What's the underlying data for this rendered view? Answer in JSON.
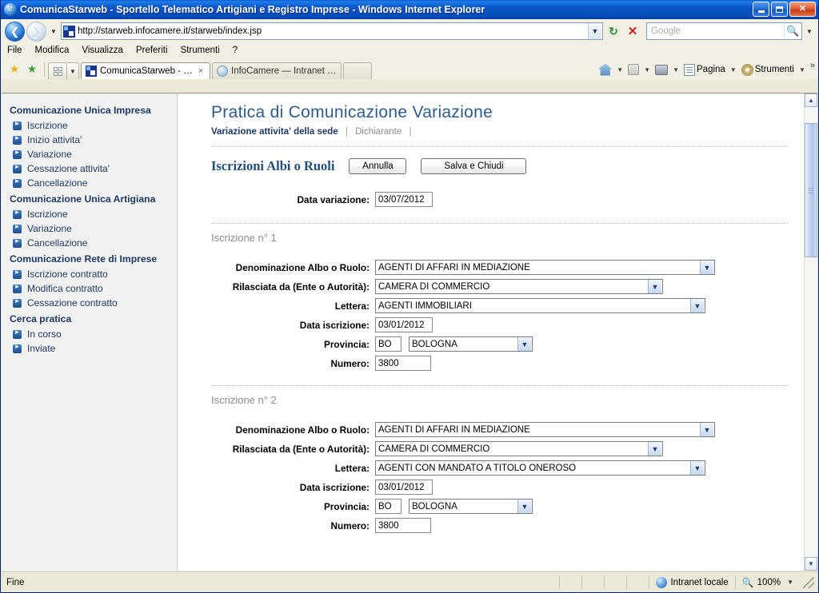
{
  "window": {
    "title": "ComunicaStarweb - Sportello Telematico Artigiani e Registro Imprese - Windows Internet Explorer",
    "minimize_label": "Riduci a icona",
    "maximize_label": "Ripristina",
    "close_label": "Chiudi"
  },
  "navigation": {
    "back_label": "Indietro",
    "forward_label": "Avanti",
    "history_caret": "▼",
    "url": "http://starweb.infocamere.it/starweb/index.jsp",
    "url_caret": "▼",
    "refresh_label": "Aggiorna",
    "stop_label": "Interrompi",
    "search_placeholder": "Google",
    "search_go_label": "Cerca",
    "search_caret": "▼"
  },
  "menubar": {
    "items": [
      "File",
      "Modifica",
      "Visualizza",
      "Preferiti",
      "Strumenti",
      "?"
    ]
  },
  "tabbar": {
    "favorites_label": "Preferiti",
    "add_favorite_label": "Aggiungi a Preferiti",
    "quicktabs_label": "Schede rapide",
    "quicktabs_caret": "▼",
    "tabs": [
      {
        "label": "ComunicaStarweb - Sport...",
        "close": "×",
        "active": true
      },
      {
        "label": "InfoCamere — Intranet Bolo...",
        "active": false
      },
      {
        "label": "",
        "active": false
      }
    ],
    "commands": [
      {
        "label": "",
        "icon": "home-icon",
        "caret": "▼"
      },
      {
        "label": "",
        "icon": "feed-icon",
        "caret": "▼"
      },
      {
        "label": "",
        "icon": "print-icon",
        "caret": "▼"
      },
      {
        "label": "Pagina",
        "icon": "page-icon",
        "caret": "▼"
      },
      {
        "label": "Strumenti",
        "icon": "gear-icon",
        "caret": "▼"
      }
    ],
    "more_label": "»"
  },
  "sidebar": {
    "groups": [
      {
        "title": "Comunicazione Unica Impresa",
        "items": [
          "Iscrizione",
          "Inizio attivita'",
          "Variazione",
          "Cessazione attivita'",
          "Cancellazione"
        ]
      },
      {
        "title": "Comunicazione Unica Artigiana",
        "items": [
          "Iscrizione",
          "Variazione",
          "Cancellazione"
        ]
      },
      {
        "title": "Comunicazione Rete di Imprese",
        "items": [
          "Iscrizione contratto",
          "Modifica contratto",
          "Cessazione contratto"
        ]
      },
      {
        "title": "Cerca pratica",
        "items": [
          "In corso",
          "Inviate"
        ]
      }
    ]
  },
  "main": {
    "page_title": "Pratica di Comunicazione Variazione",
    "breadcrumbs": [
      {
        "label": "Variazione attivita' della sede",
        "active": true
      },
      {
        "label": "Dichiarante",
        "active": false
      }
    ],
    "breadcrumb_separator": "|",
    "section_title": "Iscrizioni Albi o Ruoli",
    "buttons": {
      "cancel": "Annulla",
      "save_close": "Salva e Chiudi"
    },
    "data_variazione": {
      "label": "Data variazione:",
      "value": "03/07/2012"
    },
    "field_labels": {
      "denominazione": "Denominazione Albo o Ruolo:",
      "rilasciata": "Rilasciata da (Ente o Autorità):",
      "lettera": "Lettera:",
      "data_iscrizione": "Data iscrizione:",
      "provincia": "Provincia:",
      "numero": "Numero:"
    },
    "dropdown_caret": "▼",
    "iscrizioni": [
      {
        "heading": "Iscrizione n° 1",
        "denominazione": "AGENTI DI AFFARI IN MEDIAZIONE",
        "rilasciata": "CAMERA DI COMMERCIO",
        "lettera": "AGENTI IMMOBILIARI",
        "data_iscrizione": "03/01/2012",
        "provincia_sigla": "BO",
        "provincia_nome": "BOLOGNA",
        "numero": "3800"
      },
      {
        "heading": "Iscrizione n° 2",
        "denominazione": "AGENTI DI AFFARI IN MEDIAZIONE",
        "rilasciata": "CAMERA DI COMMERCIO",
        "lettera": "AGENTI CON MANDATO A TITOLO ONEROSO",
        "data_iscrizione": "03/01/2012",
        "provincia_sigla": "BO",
        "provincia_nome": "BOLOGNA",
        "numero": "3800"
      }
    ]
  },
  "scrollbar": {
    "up_arrow": "▲",
    "down_arrow": "▼"
  },
  "statusbar": {
    "status": "Fine",
    "zone": "Intranet locale",
    "zoom": "100%",
    "zoom_caret": "▼"
  },
  "colors": {
    "titlebar_blue": "#0a55c8",
    "accent_navy": "#1f3864",
    "heading_blue": "#2e5c8a",
    "section_blue": "#1f4e79",
    "sidebar_bg": "#f2f2f2",
    "chrome_bg": "#ece9d8"
  }
}
